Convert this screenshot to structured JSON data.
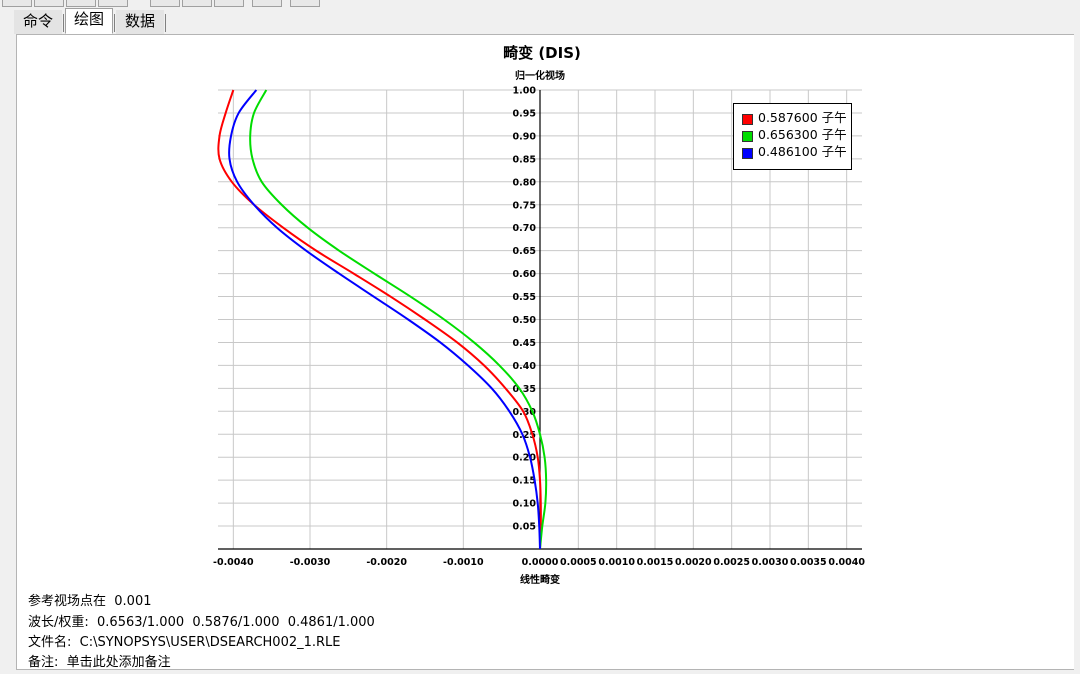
{
  "tabs": [
    {
      "label": "命令"
    },
    {
      "label": "绘图"
    },
    {
      "label": "数据"
    }
  ],
  "active_tab": "绘图",
  "footer": {
    "ref_label": "参考视场点在",
    "ref_value": "0.001",
    "wave_label": "波长/权重:",
    "wave_value": "0.6563/1.000  0.5876/1.000  0.4861/1.000",
    "file_label": "文件名:",
    "file_value": "C:\\SYNOPSYS\\USER\\DSEARCH002_1.RLE",
    "note_label": "备注:",
    "note_value": "单击此处添加备注"
  },
  "chart_data": {
    "type": "line",
    "title": "畸变 (DIS)",
    "ylabel": "归一化视场",
    "xlabel": "线性畸变",
    "xlim": [
      -0.0042,
      0.0042
    ],
    "ylim": [
      0,
      1.0
    ],
    "x_ticks": [
      "-0.0040",
      "-0.0030",
      "-0.0020",
      "-0.0010",
      "0.0000",
      "0.0005",
      "0.0010",
      "0.0015",
      "0.0020",
      "0.0025",
      "0.0030",
      "0.0035",
      "0.0040"
    ],
    "x_tick_values": [
      -0.004,
      -0.003,
      -0.002,
      -0.001,
      0.0,
      0.0005,
      0.001,
      0.0015,
      0.002,
      0.0025,
      0.003,
      0.0035,
      0.004
    ],
    "y_ticks": [
      "0.05",
      "0.10",
      "0.15",
      "0.20",
      "0.25",
      "0.30",
      "0.35",
      "0.40",
      "0.45",
      "0.50",
      "0.55",
      "0.60",
      "0.65",
      "0.70",
      "0.75",
      "0.80",
      "0.85",
      "0.90",
      "0.95",
      "1.00"
    ],
    "y_tick_values": [
      0.05,
      0.1,
      0.15,
      0.2,
      0.25,
      0.3,
      0.35,
      0.4,
      0.45,
      0.5,
      0.55,
      0.6,
      0.65,
      0.7,
      0.75,
      0.8,
      0.85,
      0.9,
      0.95,
      1.0
    ],
    "grid": true,
    "legend_position": "top-right",
    "series": [
      {
        "name": "0.587600 子午",
        "color": "#ff0000",
        "y": [
          0,
          0.05,
          0.1,
          0.15,
          0.2,
          0.25,
          0.3,
          0.35,
          0.4,
          0.45,
          0.5,
          0.55,
          0.6,
          0.65,
          0.7,
          0.75,
          0.8,
          0.85,
          0.9,
          0.95,
          1.0
        ],
        "x": [
          0.0,
          1e-05,
          1e-05,
          0.0,
          -3e-05,
          -0.0001,
          -0.00022,
          -0.00045,
          -0.00073,
          -0.00108,
          -0.0015,
          -0.00195,
          -0.00243,
          -0.00292,
          -0.00335,
          -0.00373,
          -0.00402,
          -0.00418,
          -0.00418,
          -0.0041,
          -0.004
        ]
      },
      {
        "name": "0.656300 子午",
        "color": "#00dd00",
        "y": [
          0,
          0.05,
          0.1,
          0.15,
          0.2,
          0.25,
          0.3,
          0.35,
          0.4,
          0.45,
          0.5,
          0.55,
          0.6,
          0.65,
          0.7,
          0.75,
          0.8,
          0.85,
          0.9,
          0.95,
          1.0
        ],
        "x": [
          0.0,
          3e-05,
          7e-05,
          8e-05,
          6e-05,
          0.0,
          -0.0001,
          -0.00027,
          -0.00053,
          -0.00086,
          -0.00125,
          -0.00169,
          -0.00216,
          -0.00262,
          -0.00303,
          -0.00337,
          -0.00363,
          -0.00375,
          -0.00378,
          -0.00373,
          -0.00357
        ]
      },
      {
        "name": "0.486100 子午",
        "color": "#0000ff",
        "y": [
          0,
          0.05,
          0.1,
          0.15,
          0.2,
          0.25,
          0.3,
          0.35,
          0.4,
          0.45,
          0.5,
          0.55,
          0.6,
          0.65,
          0.7,
          0.75,
          0.8,
          0.85,
          0.9,
          0.95,
          1.0
        ],
        "x": [
          0.0,
          -1e-05,
          -3e-05,
          -7e-05,
          -0.00013,
          -0.00023,
          -0.0004,
          -0.00063,
          -0.00094,
          -0.0013,
          -0.00172,
          -0.00217,
          -0.00262,
          -0.00305,
          -0.00343,
          -0.00373,
          -0.00395,
          -0.00405,
          -0.00403,
          -0.00393,
          -0.0037
        ]
      }
    ]
  }
}
